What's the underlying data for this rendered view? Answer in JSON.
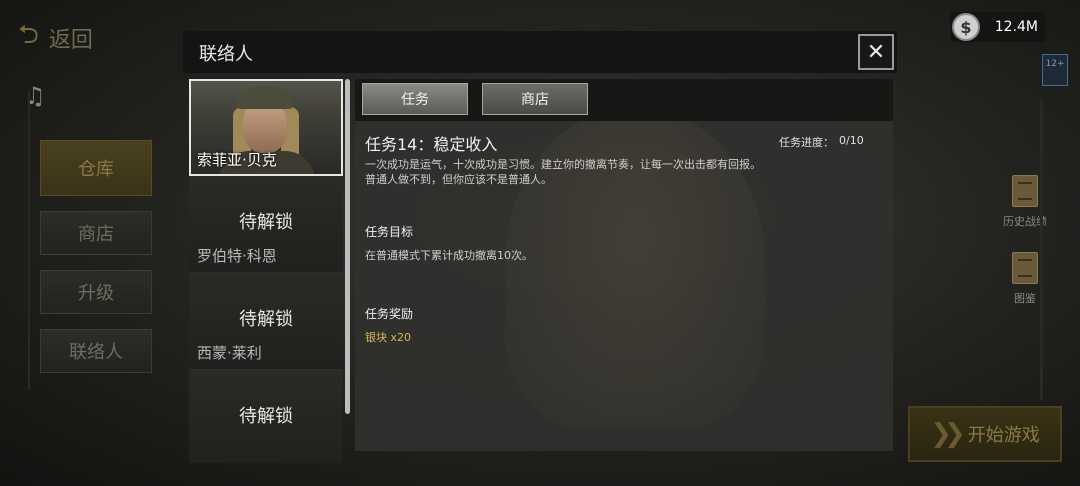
{
  "background": {
    "back_label": "返回",
    "side_menu": [
      "仓库",
      "商店",
      "升级",
      "联络人"
    ],
    "currency_value": "12.4M",
    "age_badge": "12+",
    "right_items": [
      "历史战绩",
      "图鉴"
    ],
    "start_label": "开始游戏"
  },
  "dialog": {
    "title": "联络人",
    "contacts": [
      {
        "name": "索菲亚·贝克",
        "locked": false,
        "locked_label": ""
      },
      {
        "name": "罗伯特·科恩",
        "locked": true,
        "locked_label": "待解锁"
      },
      {
        "name": "西蒙·莱利",
        "locked": true,
        "locked_label": "待解锁"
      },
      {
        "name": "",
        "locked": true,
        "locked_label": "待解锁"
      }
    ],
    "tabs": [
      "任务",
      "商店"
    ],
    "task": {
      "title": "任务14：稳定收入",
      "progress_label": "任务进度：",
      "progress_value": "0/10",
      "description_line1": "一次成功是运气，十次成功是习惯。建立你的撤离节奏，让每一次出击都有回报。",
      "description_line2": "普通人做不到，但你应该不是普通人。",
      "objective_heading": "任务目标",
      "objective_text": "在普通模式下累计成功撤离10次。",
      "reward_heading": "任务奖励",
      "reward_text": "银块 x20"
    }
  }
}
